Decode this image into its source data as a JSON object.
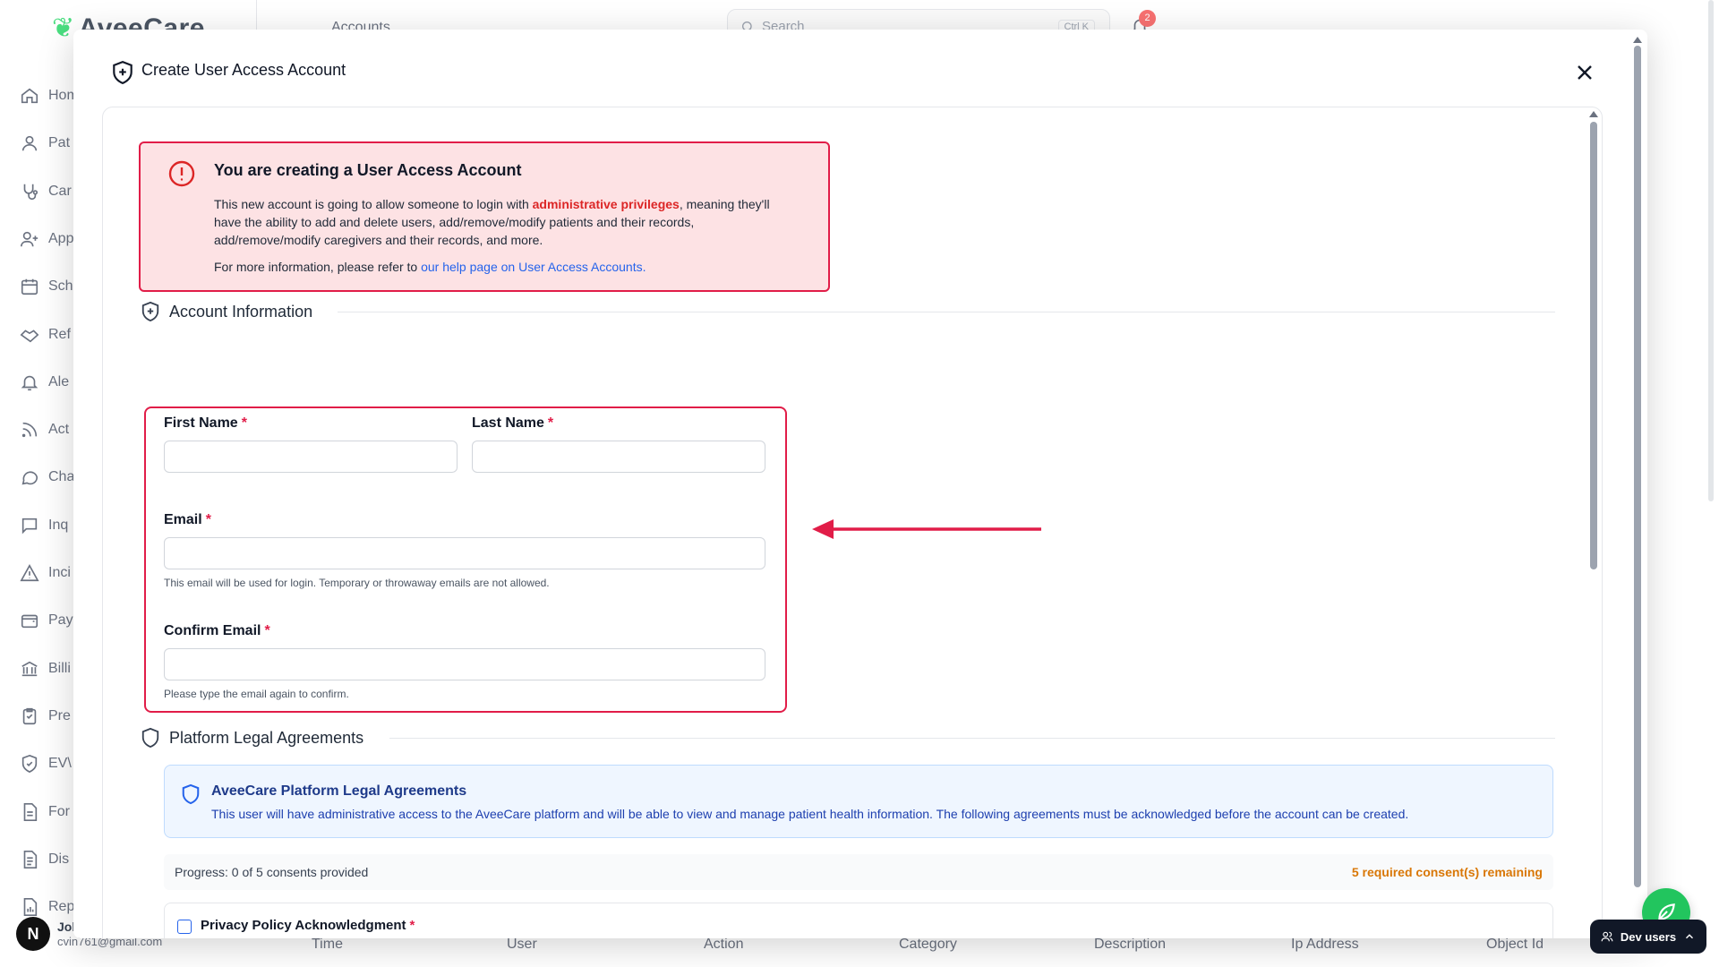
{
  "background": {
    "logo": "AveeCare",
    "topbar_title": "Accounts",
    "search_placeholder": "Search",
    "search_shortcut": "Ctrl K",
    "notification_count": "2",
    "sidebar": [
      {
        "label": "Hom",
        "icon": "home-icon"
      },
      {
        "label": "Pat",
        "icon": "user-icon"
      },
      {
        "label": "Car",
        "icon": "stethoscope-icon"
      },
      {
        "label": "App",
        "icon": "user-plus-icon"
      },
      {
        "label": "Sch",
        "icon": "calendar-icon"
      },
      {
        "label": "Ref",
        "icon": "handshake-icon"
      },
      {
        "label": "Ale",
        "icon": "bell-icon"
      },
      {
        "label": "Act",
        "icon": "rss-icon"
      },
      {
        "label": "Cha",
        "icon": "chat-icon"
      },
      {
        "label": "Inq",
        "icon": "message-square-icon"
      },
      {
        "label": "Inci",
        "icon": "alert-triangle-icon"
      },
      {
        "label": "Pay",
        "icon": "wallet-icon"
      },
      {
        "label": "Billi",
        "icon": "bank-icon"
      },
      {
        "label": "Pre",
        "icon": "clipboard-check-icon"
      },
      {
        "label": "EV\\",
        "icon": "shield-check-icon"
      },
      {
        "label": "For",
        "icon": "file-text-icon"
      },
      {
        "label": "Dis",
        "icon": "file-lines-icon"
      },
      {
        "label": "Rep",
        "icon": "file-chart-icon"
      }
    ],
    "user": {
      "initial": "N",
      "name": "Joh",
      "email": "cvin761@gmail.com"
    },
    "table_headers": [
      "Time",
      "User",
      "Action",
      "Category",
      "Description",
      "Ip Address",
      "Object Id"
    ]
  },
  "modal": {
    "title": "Create User Access Account",
    "warning": {
      "title": "You are creating a User Access Account",
      "body_pre": "This new account is going to allow someone to login with ",
      "body_strong": "administrative privileges",
      "body_post": ", meaning they'll have the ability to add and delete users, add/remove/modify patients and their records, add/remove/modify caregivers and their records, and more.",
      "more_pre": "For more information, please refer to ",
      "more_link": "our help page on User Access Accounts."
    },
    "account_section": "Account Information",
    "fields": {
      "first_name": {
        "label": "First Name",
        "required": "*",
        "value": ""
      },
      "last_name": {
        "label": "Last Name",
        "required": "*",
        "value": ""
      },
      "email": {
        "label": "Email",
        "required": "*",
        "value": "",
        "help": "This email will be used for login. Temporary or throwaway emails are not allowed."
      },
      "confirm_email": {
        "label": "Confirm Email",
        "required": "*",
        "value": "",
        "help": "Please type the email again to confirm."
      }
    },
    "legal_section": "Platform Legal Agreements",
    "legal_info": {
      "title": "AveeCare Platform Legal Agreements",
      "description": "This user will have administrative access to the AveeCare platform and will be able to view and manage patient health information. The following agreements must be acknowledged before the account can be created."
    },
    "progress": {
      "text": "Progress: 0 of 5 consents provided",
      "remaining": "5 required consent(s) remaining"
    },
    "consents": [
      {
        "label": "Privacy Policy Acknowledgment",
        "required": "*"
      }
    ]
  },
  "dev_users_label": "Dev users",
  "colors": {
    "accent_red": "#e11d48",
    "warning_bg": "#fde2e4",
    "link_blue": "#2563eb",
    "fab_green": "#22c55e",
    "orange": "#d97706"
  }
}
